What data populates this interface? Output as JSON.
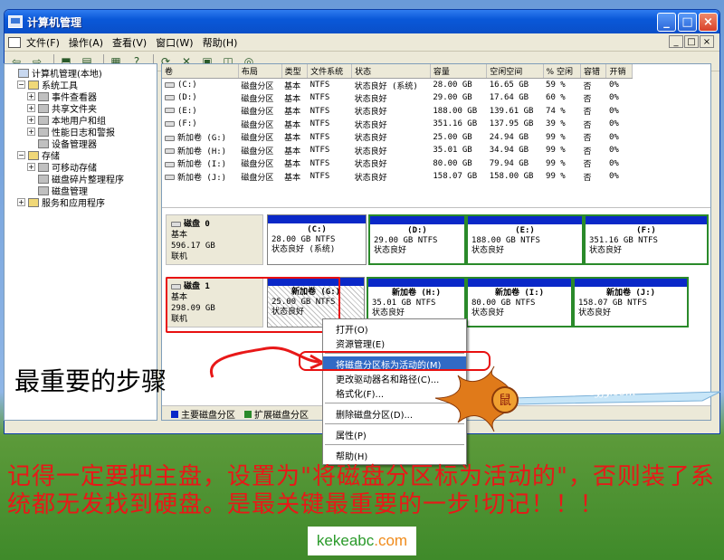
{
  "window": {
    "title": "计算机管理"
  },
  "menu": [
    "文件(F)",
    "操作(A)",
    "查看(V)",
    "窗口(W)",
    "帮助(H)"
  ],
  "mdi_buttons": [
    "_",
    "□",
    "×"
  ],
  "toolbar_icons": [
    "back-icon",
    "forward-icon",
    "up-icon",
    "show-hide-tree-icon",
    "properties-icon",
    "help-icon",
    "refresh-icon",
    "delete-icon",
    "export-icon",
    "settings-icon",
    "rescan-icon"
  ],
  "tree": [
    {
      "label": "计算机管理(本地)",
      "level": 0,
      "exp": ""
    },
    {
      "label": "系统工具",
      "level": 1,
      "exp": "−"
    },
    {
      "label": "事件查看器",
      "level": 2,
      "exp": "+"
    },
    {
      "label": "共享文件夹",
      "level": 2,
      "exp": "+"
    },
    {
      "label": "本地用户和组",
      "level": 2,
      "exp": "+"
    },
    {
      "label": "性能日志和警报",
      "level": 2,
      "exp": "+"
    },
    {
      "label": "设备管理器",
      "level": 2,
      "exp": ""
    },
    {
      "label": "存储",
      "level": 1,
      "exp": "−"
    },
    {
      "label": "可移动存储",
      "level": 2,
      "exp": "+"
    },
    {
      "label": "磁盘碎片整理程序",
      "level": 2,
      "exp": ""
    },
    {
      "label": "磁盘管理",
      "level": 2,
      "exp": ""
    },
    {
      "label": "服务和应用程序",
      "level": 1,
      "exp": "+"
    }
  ],
  "table": {
    "headers": [
      "卷",
      "布局",
      "类型",
      "文件系统",
      "状态",
      "容量",
      "空闲空间",
      "% 空闲",
      "容错",
      "开销"
    ],
    "rows": [
      [
        "(C:)",
        "磁盘分区",
        "基本",
        "NTFS",
        "状态良好 (系统)",
        "28.00 GB",
        "16.65 GB",
        "59 %",
        "否",
        "0%"
      ],
      [
        "(D:)",
        "磁盘分区",
        "基本",
        "NTFS",
        "状态良好",
        "29.00 GB",
        "17.64 GB",
        "60 %",
        "否",
        "0%"
      ],
      [
        "(E:)",
        "磁盘分区",
        "基本",
        "NTFS",
        "状态良好",
        "188.00 GB",
        "139.61 GB",
        "74 %",
        "否",
        "0%"
      ],
      [
        "(F:)",
        "磁盘分区",
        "基本",
        "NTFS",
        "状态良好",
        "351.16 GB",
        "137.95 GB",
        "39 %",
        "否",
        "0%"
      ],
      [
        "新加卷 (G:)",
        "磁盘分区",
        "基本",
        "NTFS",
        "状态良好",
        "25.00 GB",
        "24.94 GB",
        "99 %",
        "否",
        "0%"
      ],
      [
        "新加卷 (H:)",
        "磁盘分区",
        "基本",
        "NTFS",
        "状态良好",
        "35.01 GB",
        "34.94 GB",
        "99 %",
        "否",
        "0%"
      ],
      [
        "新加卷 (I:)",
        "磁盘分区",
        "基本",
        "NTFS",
        "状态良好",
        "80.00 GB",
        "79.94 GB",
        "99 %",
        "否",
        "0%"
      ],
      [
        "新加卷 (J:)",
        "磁盘分区",
        "基本",
        "NTFS",
        "状态良好",
        "158.07 GB",
        "158.00 GB",
        "99 %",
        "否",
        "0%"
      ]
    ]
  },
  "disk0": {
    "name": "磁盘 0",
    "type": "基本",
    "size": "596.17 GB",
    "status": "联机",
    "parts": [
      {
        "name": "(C:)",
        "size": "28.00 GB NTFS",
        "status": "状态良好 (系统)"
      },
      {
        "name": "(D:)",
        "size": "29.00 GB NTFS",
        "status": "状态良好"
      },
      {
        "name": "(E:)",
        "size": "188.00 GB NTFS",
        "status": "状态良好"
      },
      {
        "name": "(F:)",
        "size": "351.16 GB NTFS",
        "status": "状态良好"
      }
    ]
  },
  "disk1": {
    "name": "磁盘 1",
    "type": "基本",
    "size": "298.09 GB",
    "status": "联机",
    "parts": [
      {
        "name": "新加卷 (G:)",
        "size": "25.00 GB NTFS",
        "status": "状态良好"
      },
      {
        "name": "新加卷 (H:)",
        "size": "35.01 GB NTFS",
        "status": "状态良好"
      },
      {
        "name": "新加卷 (I:)",
        "size": "80.00 GB NTFS",
        "status": "状态良好"
      },
      {
        "name": "新加卷 (J:)",
        "size": "158.07 GB NTFS",
        "status": "状态良好"
      }
    ]
  },
  "legend": [
    {
      "label": "主要磁盘分区",
      "color": "#0a28c8"
    },
    {
      "label": "扩展磁盘分区",
      "color": "#2a8a2a"
    }
  ],
  "context_menu": {
    "open": "打开(O)",
    "explore": "资源管理(E)",
    "mark_active": "将磁盘分区标为活动的(M)",
    "change_letter": "更改驱动器名和路径(C)...",
    "format": "格式化(F)...",
    "delete": "删除磁盘分区(D)...",
    "properties": "属性(P)",
    "help": "帮助(H)"
  },
  "annotation": {
    "step_label": "最重要的步骤",
    "note": "记得一定要把主盘，设置为\"将磁盘分区标为活动的\"，否则装了系统都无发找到硬盘。是最关键最重要的一步!切记！！！",
    "watermark": "www.sssyjy.com",
    "seal": "鼠",
    "badge_a": "kekeabc",
    "badge_b": ".com"
  },
  "colors": {
    "primary_partition": "#0a28c8",
    "extended_partition": "#2a8a2a",
    "highlight": "#316ac5",
    "annotation_red": "#e81818"
  }
}
